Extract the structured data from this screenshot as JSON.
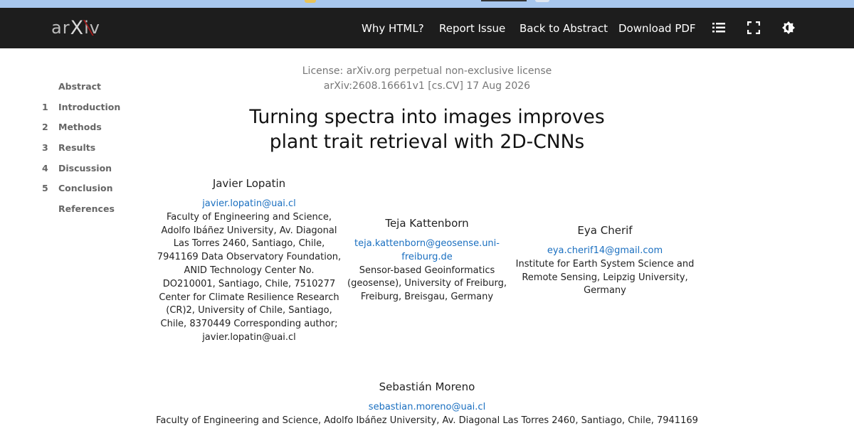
{
  "navbar": {
    "logo": "arXiv",
    "links": [
      "Why HTML?",
      "Report Issue",
      "Back to Abstract",
      "Download PDF"
    ],
    "icons": [
      "list-icon",
      "fullscreen-icon",
      "theme-icon"
    ]
  },
  "toc": [
    {
      "num": "",
      "label": "Abstract"
    },
    {
      "num": "1",
      "label": "Introduction"
    },
    {
      "num": "2",
      "label": "Methods"
    },
    {
      "num": "3",
      "label": "Results"
    },
    {
      "num": "4",
      "label": "Discussion"
    },
    {
      "num": "5",
      "label": "Conclusion"
    },
    {
      "num": "",
      "label": "References"
    }
  ],
  "paper": {
    "license": "License: arXiv.org perpetual non-exclusive license",
    "arxiv_id": "arXiv:2608.16661v1 [cs.CV] 17 Aug 2026",
    "title_line1": "Turning spectra into images improves",
    "title_line2": "plant trait retrieval with 2D-CNNs"
  },
  "authors": [
    {
      "name": "Javier Lopatin",
      "email": "javier.lopatin@uai.cl",
      "affil_lines": [
        "Faculty of Engineering and Science,",
        "Adolfo Ibáñez University, Av. Diagonal",
        "Las Torres 2460, Santiago, Chile,",
        "7941169 Data Observatory Foundation,",
        "ANID Technology Center No.",
        "DO210001, Santiago, Chile, 7510277",
        "Center for Climate Resilience Research",
        "(CR)2, University of Chile, Santiago,",
        "Chile, 8370449 Corresponding author;",
        "javier.lopatin@uai.cl"
      ]
    },
    {
      "name": "Teja Kattenborn",
      "email_lines": [
        "teja.kattenborn@geosense.uni-",
        "freiburg.de"
      ],
      "affil_lines": [
        "Sensor-based Geoinformatics",
        "(geosense), University of Freiburg,",
        "Freiburg, Breisgau, Germany"
      ]
    },
    {
      "name": "Eya Cherif",
      "email": "eya.cherif14@gmail.com",
      "affil_lines": [
        "Institute for Earth System Science and",
        "Remote Sensing, Leipzig University,",
        "Germany"
      ]
    },
    {
      "name": "Sebastián Moreno",
      "email": "sebastian.moreno@uai.cl",
      "affil_lines": [
        "Faculty of Engineering and Science, Adolfo Ibáñez University, Av. Diagonal Las Torres 2460, Santiago, Chile, 7941169"
      ]
    }
  ]
}
